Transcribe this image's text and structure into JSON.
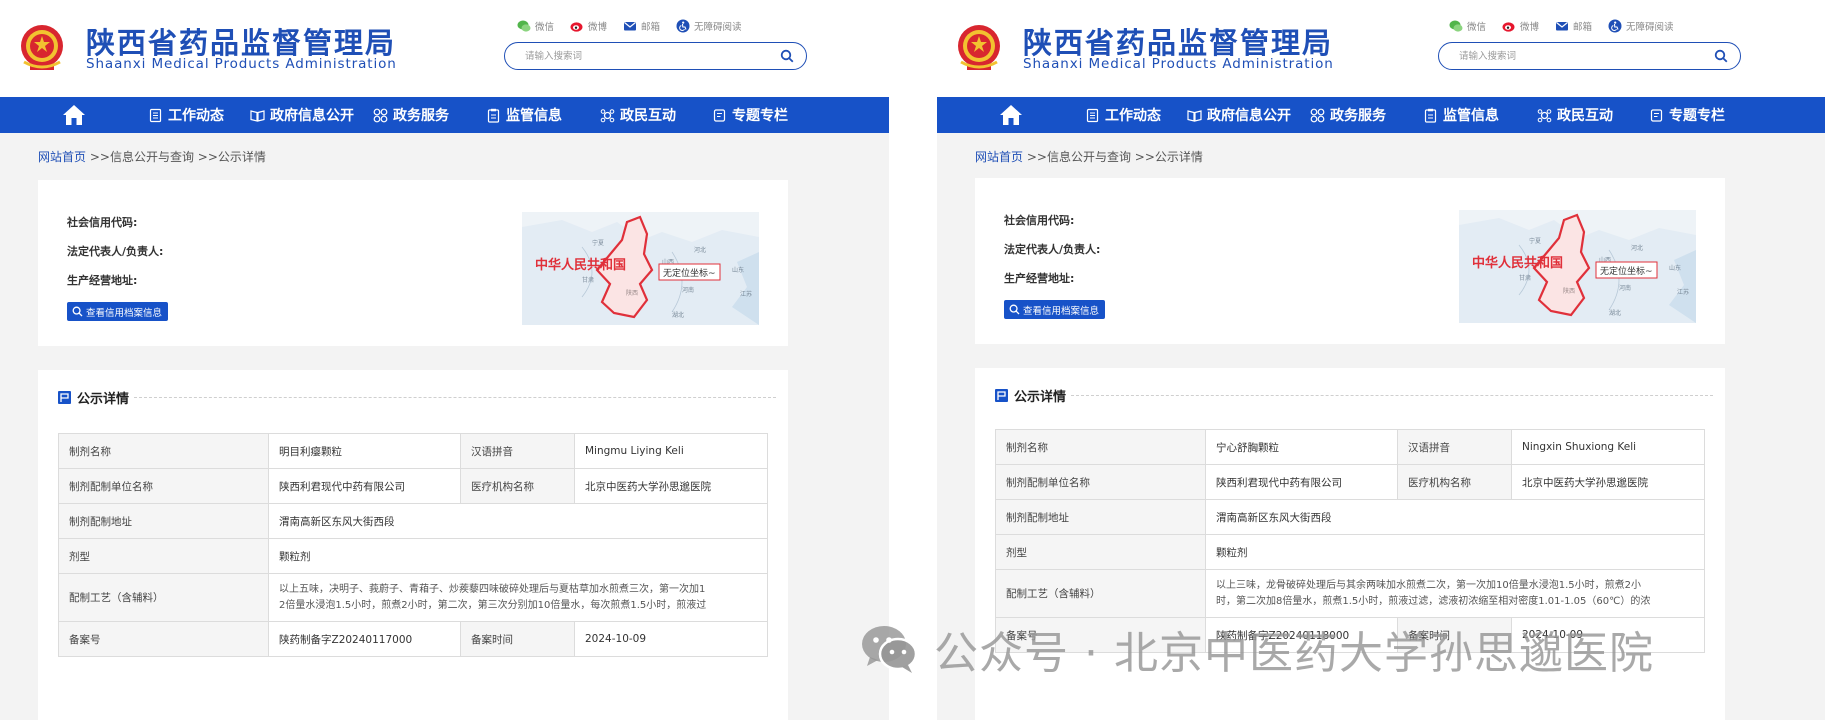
{
  "colors": {
    "brand_blue": "#1752c8",
    "title_blue": "#1f4fb6",
    "map_red": "#e0303a"
  },
  "header": {
    "title": "陕西省药品监督管理局",
    "subtitle": "Shaanxi Medical Products Administration",
    "tools": [
      {
        "label": "微信",
        "icon": "wechat-icon"
      },
      {
        "label": "微博",
        "icon": "weibo-icon"
      },
      {
        "label": "邮箱",
        "icon": "mail-icon"
      },
      {
        "label": "无障碍阅读",
        "icon": "accessibility-icon"
      }
    ],
    "search_placeholder": "请输入搜索词"
  },
  "nav": [
    {
      "label": "工作动态",
      "icon": "document-list-icon"
    },
    {
      "label": "政府信息公开",
      "icon": "open-book-icon"
    },
    {
      "label": "政务服务",
      "icon": "grid-circles-icon"
    },
    {
      "label": "监管信息",
      "icon": "clipboard-icon"
    },
    {
      "label": "政民互动",
      "icon": "interaction-icon"
    },
    {
      "label": "专题专栏",
      "icon": "column-icon"
    }
  ],
  "breadcrumb": {
    "home": "网站首页",
    "sep": ">>",
    "level2": "信息公开与查询",
    "level3": "公示详情"
  },
  "info_card": {
    "credit_code_label": "社会信用代码:",
    "legal_rep_label": "法定代表人/负责人:",
    "address_label": "生产经营地址:",
    "button_label": "查看信用档案信息",
    "map_country": "中华人民共和国",
    "map_note": "无定位坐标~",
    "map_places": [
      "宁夏",
      "河北",
      "山西",
      "甘肃",
      "陕西",
      "河南",
      "山东",
      "江苏",
      "湖北"
    ]
  },
  "section_title": "公示详情",
  "field_labels": {
    "name": "制剂名称",
    "pinyin": "汉语拼音",
    "maker": "制剂配制单位名称",
    "institution": "医疗机构名称",
    "address": "制剂配制地址",
    "form": "剂型",
    "process": "配制工艺（含辅料）",
    "record_no": "备案号",
    "record_time": "备案时间"
  },
  "records": [
    {
      "name": "明目利瘿颗粒",
      "pinyin": "Mingmu Liying Keli",
      "maker": "陕西利君现代中药有限公司",
      "institution": "北京中医药大学孙思邈医院",
      "address": "渭南高新区东风大街西段",
      "form": "颗粒剂",
      "process_line1": "以上五味，决明子、莪蔚子、青葙子、炒蒺藜四味破碎处理后与夏枯草加水煎煮三次，第一次加1",
      "process_line2": "2倍量水浸泡1.5小时，煎煮2小时，第二次，第三次分别加10倍量水，每次煎煮1.5小时，煎液过",
      "record_no": "陕药制备字Z20240117000",
      "record_time": "2024-10-09"
    },
    {
      "name": "宁心舒胸颗粒",
      "pinyin": "Ningxin Shuxiong Keli",
      "maker": "陕西利君现代中药有限公司",
      "institution": "北京中医药大学孙思邈医院",
      "address": "渭南高新区东风大街西段",
      "form": "颗粒剂",
      "process_line1": "以上三味，龙骨破碎处理后与其余两味加水煎煮二次，第一次加10倍量水浸泡1.5小时，煎煮2小",
      "process_line2": "时，第二次加8倍量水，煎煮1.5小时，煎液过滤，滤液初浓缩至相对密度1.01-1.05（60℃）的浓",
      "record_no": "陕药制备字Z20240118000",
      "record_time": "2024-10-09"
    }
  ],
  "watermark": "公众号 · 北京中医药大学孙思邈医院"
}
